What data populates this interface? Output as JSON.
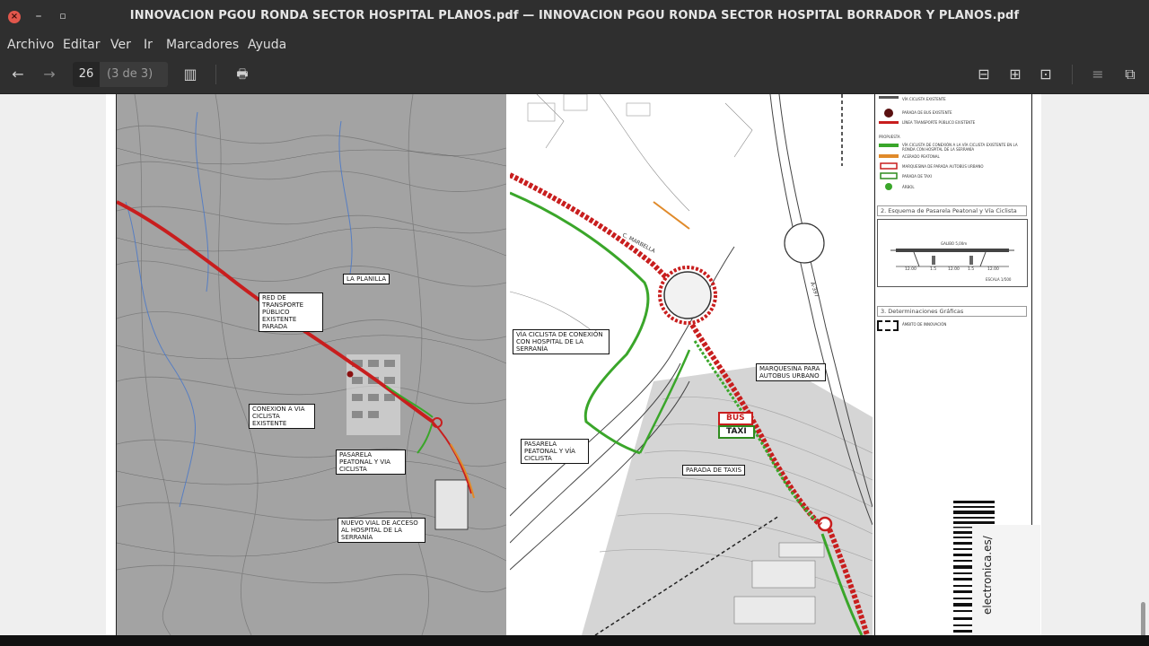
{
  "window": {
    "title": "INNOVACION PGOU RONDA SECTOR HOSPITAL PLANOS.pdf — INNOVACION PGOU RONDA SECTOR HOSPITAL BORRADOR Y PLANOS.pdf",
    "close_glyph": "×",
    "minimize_glyph": "–",
    "maximize_glyph": "▫"
  },
  "menu": [
    "Archivo",
    "Editar",
    "Ver",
    "Ir",
    "Marcadores",
    "Ayuda"
  ],
  "toolbar": {
    "back_icon": "←",
    "forward_icon": "→",
    "page_number": "26",
    "page_total": "(3 de 3)",
    "sidebar_icon": "▥",
    "print_icon": "🖶",
    "zoom_out_icon": "⊟",
    "zoom_in_icon": "⊞",
    "fit_icon": "⊡",
    "annotate_icon": "≡",
    "dual_page_icon": "⧉"
  },
  "map_left": {
    "callouts": [
      "LA PLANILLA",
      "RED DE TRANSPORTE PÚBLICO EXISTENTE PARADA",
      "CONEXION A VIA CICLISTA EXISTENTE",
      "PASARELA PEATONAL Y VIA CICLISTA",
      "NUEVO VIAL DE ACCESO AL HOSPITAL DE LA SERRANÍA"
    ]
  },
  "map_right": {
    "street_label": "C. MARBELLA",
    "road_label": "A-397",
    "callouts": [
      "VÍA CICLISTA DE CONEXIÓN CON HOSPITAL DE LA SERRANÍA",
      "MARQUESINA PARA AUTOBUS URBANO",
      "PASARELA PEATONAL Y VÍA CICLISTA",
      "PARADA DE TAXIS"
    ],
    "badges": [
      {
        "label": "BUS",
        "color": "#c81e1e"
      },
      {
        "label": "TAXI",
        "color": "#2e8b1e"
      }
    ]
  },
  "legend": {
    "items_top": [
      "VÍA CICLISTA EXISTENTE",
      "PARADA DE BUS EXISTENTE",
      "LÍNEA TRANSPORTE PÚBLICO EXISTENTE"
    ],
    "proposal_heading": "PROPUESTA",
    "items_proposal": [
      "VÍA CICLISTA DE CONEXIÓN A LA VÍA CICLISTA EXISTENTE EN LA RONDA CON HOSPITAL DE LA SERRANÍA",
      "ACERADO PEATONAL",
      "MARQUESINA DE PARADA AUTOBÚS URBANO",
      "PARADA DE TAXI",
      "ÁRBOL"
    ],
    "section2_heading": "2. Esquema de Pasarela Peatonal y Vía Ciclista",
    "section_gauge": "GALIBO 5,00m",
    "section_dims": [
      "12.00",
      "1.5",
      "12.00",
      "1.5",
      "12.00"
    ],
    "section_scale": "ESCALA 1/500",
    "section3_heading": "3. Determinaciones Gráficas",
    "section3_item": "ÁMBITO DE INNOVACIÓN"
  },
  "watermark": "electronica.es/",
  "colors": {
    "route_red": "#c81e1e",
    "route_green": "#3aa62a",
    "pedestrian_orange": "#e08a2a"
  }
}
